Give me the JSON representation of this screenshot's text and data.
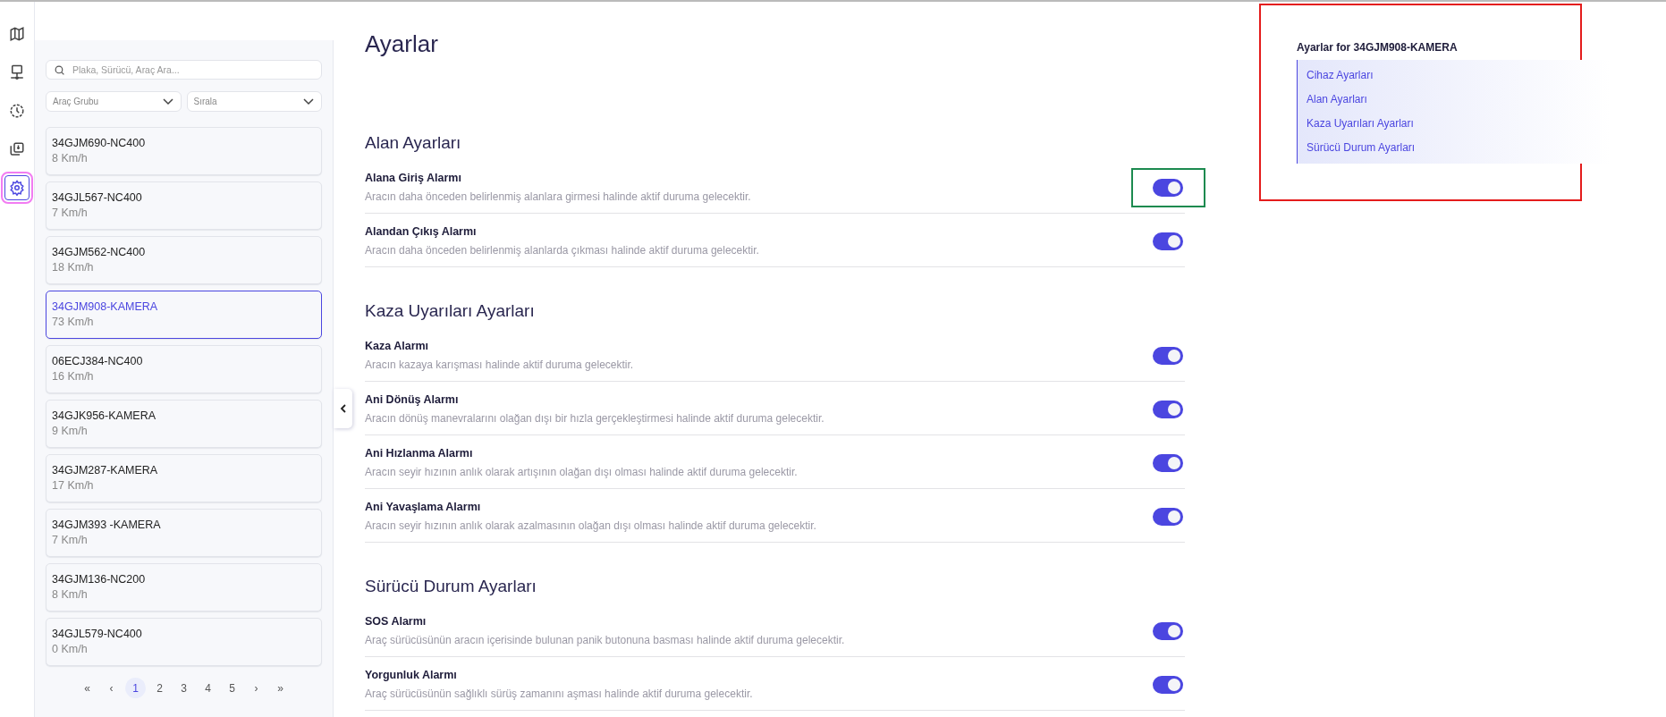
{
  "rail": [
    {
      "kind": "map",
      "selected": false
    },
    {
      "kind": "monitor",
      "selected": false
    },
    {
      "kind": "history",
      "selected": false
    },
    {
      "kind": "layers",
      "selected": false
    },
    {
      "kind": "settings",
      "selected": true
    }
  ],
  "vehicle_panel": {
    "search": {
      "placeholder": "Plaka, Sürücü, Araç Ara..."
    },
    "dropdowns": [
      {
        "placeholder": "Araç Grubu"
      },
      {
        "placeholder": "Sırala"
      }
    ],
    "vehicles": [
      {
        "plate": "34GJM690-NC400",
        "speed": "8 Km/h",
        "selected": false
      },
      {
        "plate": "34GJL567-NC400",
        "speed": "7 Km/h",
        "selected": false
      },
      {
        "plate": "34GJM562-NC400",
        "speed": "18 Km/h",
        "selected": false
      },
      {
        "plate": "34GJM908-KAMERA",
        "speed": "73 Km/h",
        "selected": true
      },
      {
        "plate": "06ECJ384-NC400",
        "speed": "16 Km/h",
        "selected": false
      },
      {
        "plate": "34GJK956-KAMERA",
        "speed": "9 Km/h",
        "selected": false
      },
      {
        "plate": "34GJM287-KAMERA",
        "speed": "17 Km/h",
        "selected": false
      },
      {
        "plate": "34GJM393 -KAMERA",
        "speed": "7 Km/h",
        "selected": false
      },
      {
        "plate": "34GJM136-NC200",
        "speed": "8 Km/h",
        "selected": false
      },
      {
        "plate": "34GJL579-NC400",
        "speed": "0 Km/h",
        "selected": false
      }
    ],
    "pagination": {
      "first": "«",
      "prev": "‹",
      "next": "›",
      "last": "»",
      "pages": [
        {
          "label": "1",
          "selected": true
        },
        {
          "label": "2",
          "selected": false
        },
        {
          "label": "3",
          "selected": false
        },
        {
          "label": "4",
          "selected": false
        },
        {
          "label": "5",
          "selected": false
        }
      ]
    }
  },
  "page_title": "Ayarlar",
  "sections": [
    {
      "title": "Alan Ayarları",
      "settings": [
        {
          "name": "Alana Giriş Alarmı",
          "description": "Aracın daha önceden belirlenmiş alanlara girmesi halinde aktif duruma gelecektir.",
          "on": true
        },
        {
          "name": "Alandan Çıkış Alarmı",
          "description": "Aracın daha önceden belirlenmiş alanlarda çıkması halinde aktif duruma gelecektir.",
          "on": true
        }
      ]
    },
    {
      "title": "Kaza Uyarıları Ayarları",
      "settings": [
        {
          "name": "Kaza Alarmı",
          "description": "Aracın kazaya karışması halinde aktif duruma gelecektir.",
          "on": true
        },
        {
          "name": "Ani Dönüş Alarmı",
          "description": "Aracın dönüş manevralarını olağan dışı bir hızla gerçekleştirmesi halinde aktif duruma gelecektir.",
          "on": true
        },
        {
          "name": "Ani Hızlanma Alarmı",
          "description": "Aracın seyir hızının anlık olarak artışının olağan dışı olması halinde aktif duruma gelecektir.",
          "on": true
        },
        {
          "name": "Ani Yavaşlama Alarmı",
          "description": "Aracın seyir hızının anlık olarak azalmasının olağan dışı olması halinde aktif duruma gelecektir.",
          "on": true
        }
      ]
    },
    {
      "title": "Sürücü Durum Ayarları",
      "settings": [
        {
          "name": "SOS Alarmı",
          "description": "Araç sürücüsünün aracın içerisinde bulunan panik butonuna basması halinde aktif duruma gelecektir.",
          "on": true
        },
        {
          "name": "Yorgunluk Alarmı",
          "description": "Araç sürücüsünün sağlıklı sürüş zamanını aşması halinde aktif duruma gelecektir.",
          "on": true
        }
      ]
    }
  ],
  "toc": {
    "title": "Ayarlar for 34GJM908-KAMERA",
    "items": [
      {
        "label": "Cihaz Ayarları"
      },
      {
        "label": "Alan Ayarları"
      },
      {
        "label": "Kaza Uyarıları Ayarları"
      },
      {
        "label": "Sürücü Durum Ayarları"
      }
    ]
  }
}
